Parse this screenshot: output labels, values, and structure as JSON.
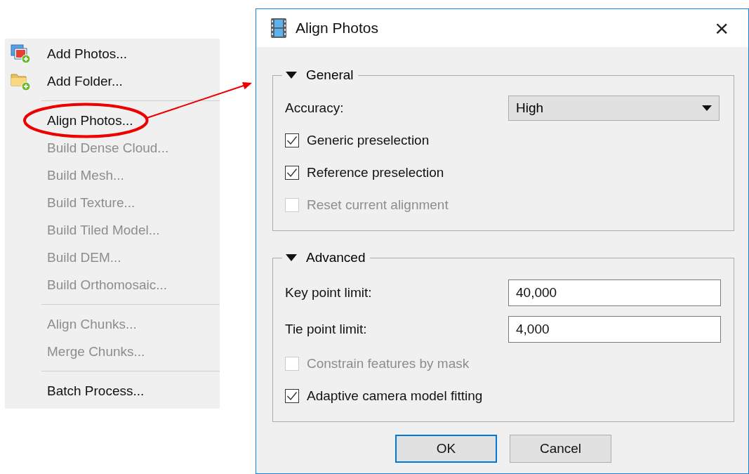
{
  "menu": {
    "sections": [
      {
        "items": [
          {
            "label": "Add Photos...",
            "kind": "photos",
            "disabled": false,
            "circled": false
          },
          {
            "label": "Add Folder...",
            "kind": "folder",
            "disabled": false,
            "circled": false
          }
        ]
      },
      {
        "items": [
          {
            "label": "Align Photos...",
            "kind": "plain",
            "disabled": false,
            "circled": true
          },
          {
            "label": "Build Dense Cloud...",
            "kind": "plain",
            "disabled": true,
            "circled": false
          },
          {
            "label": "Build Mesh...",
            "kind": "plain",
            "disabled": true,
            "circled": false
          },
          {
            "label": "Build Texture...",
            "kind": "plain",
            "disabled": true,
            "circled": false
          },
          {
            "label": "Build Tiled Model...",
            "kind": "plain",
            "disabled": true,
            "circled": false
          },
          {
            "label": "Build DEM...",
            "kind": "plain",
            "disabled": true,
            "circled": false
          },
          {
            "label": "Build Orthomosaic...",
            "kind": "plain",
            "disabled": true,
            "circled": false
          }
        ]
      },
      {
        "items": [
          {
            "label": "Align Chunks...",
            "kind": "plain",
            "disabled": true,
            "circled": false
          },
          {
            "label": "Merge Chunks...",
            "kind": "plain",
            "disabled": true,
            "circled": false
          }
        ]
      },
      {
        "items": [
          {
            "label": "Batch Process...",
            "kind": "plain",
            "disabled": false,
            "circled": false
          }
        ]
      }
    ]
  },
  "dialog": {
    "title": "Align Photos",
    "close": "×",
    "groups": [
      {
        "title": "General",
        "expanded": true,
        "rows": [
          {
            "kind": "combo",
            "label": "Accuracy:",
            "value": "High"
          },
          {
            "kind": "check",
            "label": "Generic preselection",
            "checked": true,
            "disabled": false
          },
          {
            "kind": "check",
            "label": "Reference preselection",
            "checked": true,
            "disabled": false
          },
          {
            "kind": "check",
            "label": "Reset current alignment",
            "checked": false,
            "disabled": true
          }
        ]
      },
      {
        "title": "Advanced",
        "expanded": true,
        "rows": [
          {
            "kind": "field",
            "label": "Key point limit:",
            "value": "40,000"
          },
          {
            "kind": "field",
            "label": "Tie point limit:",
            "value": "4,000"
          },
          {
            "kind": "check",
            "label": "Constrain features by mask",
            "checked": false,
            "disabled": true
          },
          {
            "kind": "check",
            "label": "Adaptive camera model fitting",
            "checked": true,
            "disabled": false
          }
        ]
      }
    ],
    "buttons": [
      {
        "label": "OK",
        "default": true
      },
      {
        "label": "Cancel",
        "default": false
      }
    ]
  }
}
